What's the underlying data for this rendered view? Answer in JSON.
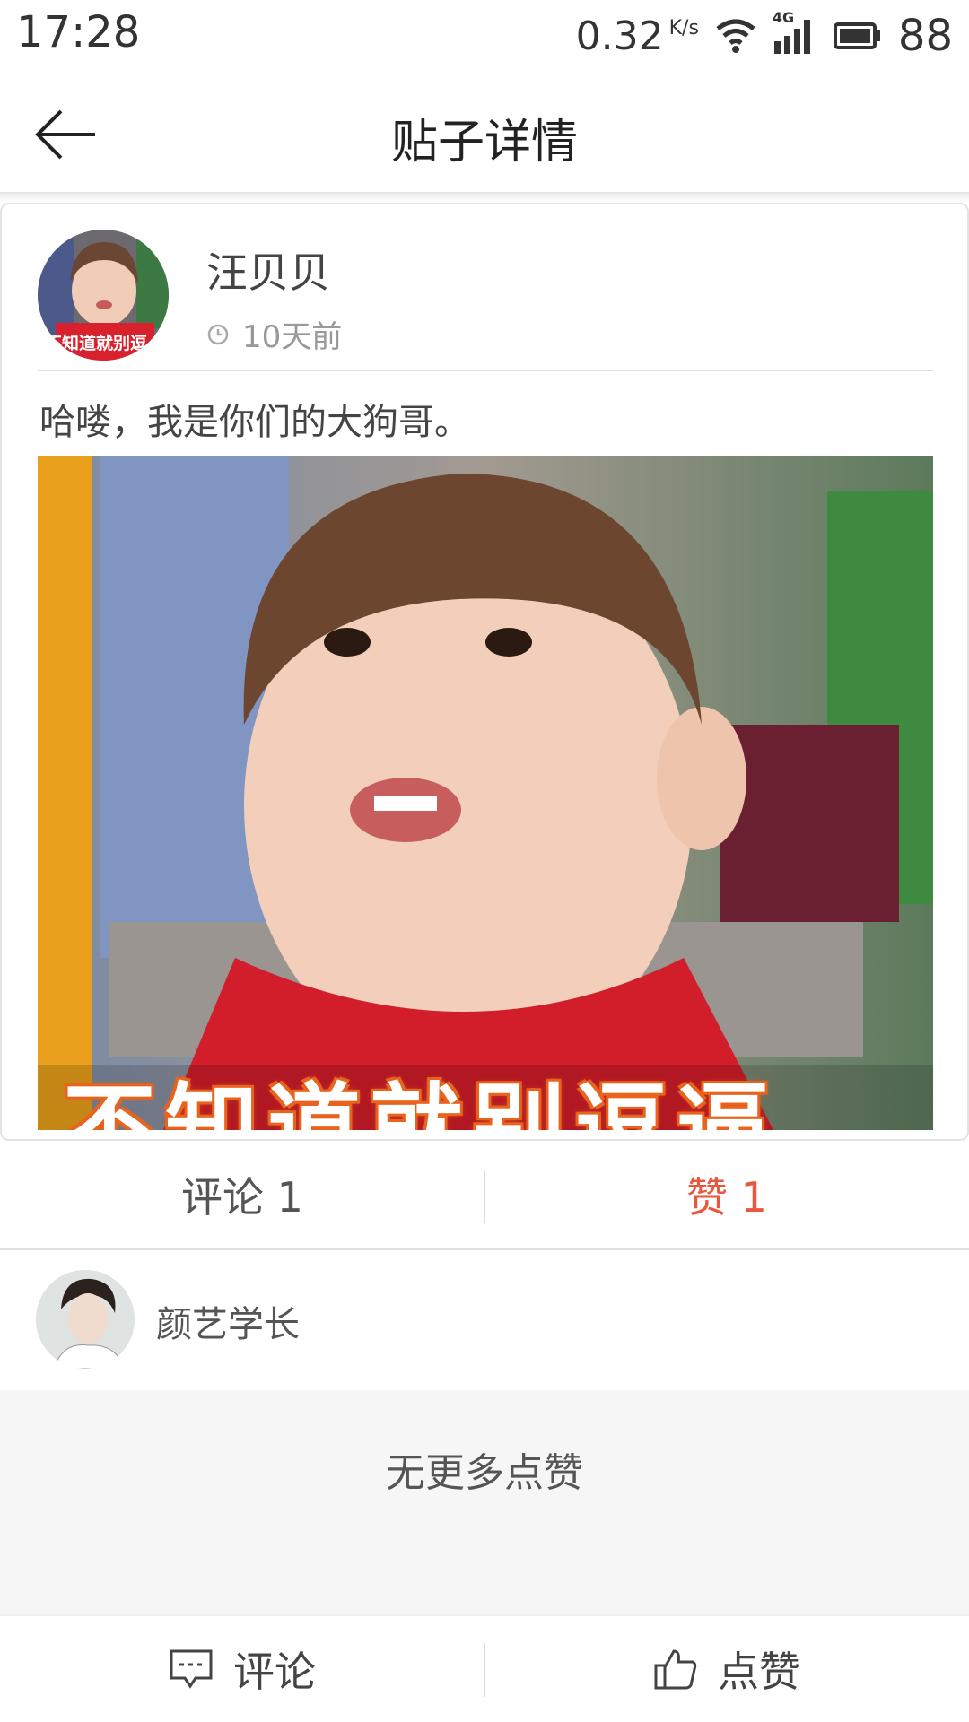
{
  "status_bar": {
    "time": "17:28",
    "net_speed": "0.32",
    "net_speed_unit": "K/s",
    "network_type": "4G",
    "battery": "88",
    "icons": [
      "wifi-icon",
      "signal-icon",
      "battery-icon"
    ]
  },
  "header": {
    "title": "贴子详情",
    "back_icon": "arrow-left-icon"
  },
  "post": {
    "author": "汪贝贝",
    "time": "10天前",
    "time_icon": "clock-icon",
    "text": "哈喽，我是你们的大狗哥。",
    "image_caption": "不知道就别逗逼",
    "avatar_caption": "不知道就别逗"
  },
  "tabs": {
    "comments_label": "评论 1",
    "likes_label": "赞 1",
    "active": "likes",
    "active_color": "#e9573f"
  },
  "likers": [
    {
      "name": "颜艺学长"
    }
  ],
  "no_more_text": "无更多点赞",
  "bottom_bar": {
    "comment_label": "评论",
    "comment_icon": "comment-icon",
    "like_label": "点赞",
    "like_icon": "thumbs-up-icon"
  }
}
